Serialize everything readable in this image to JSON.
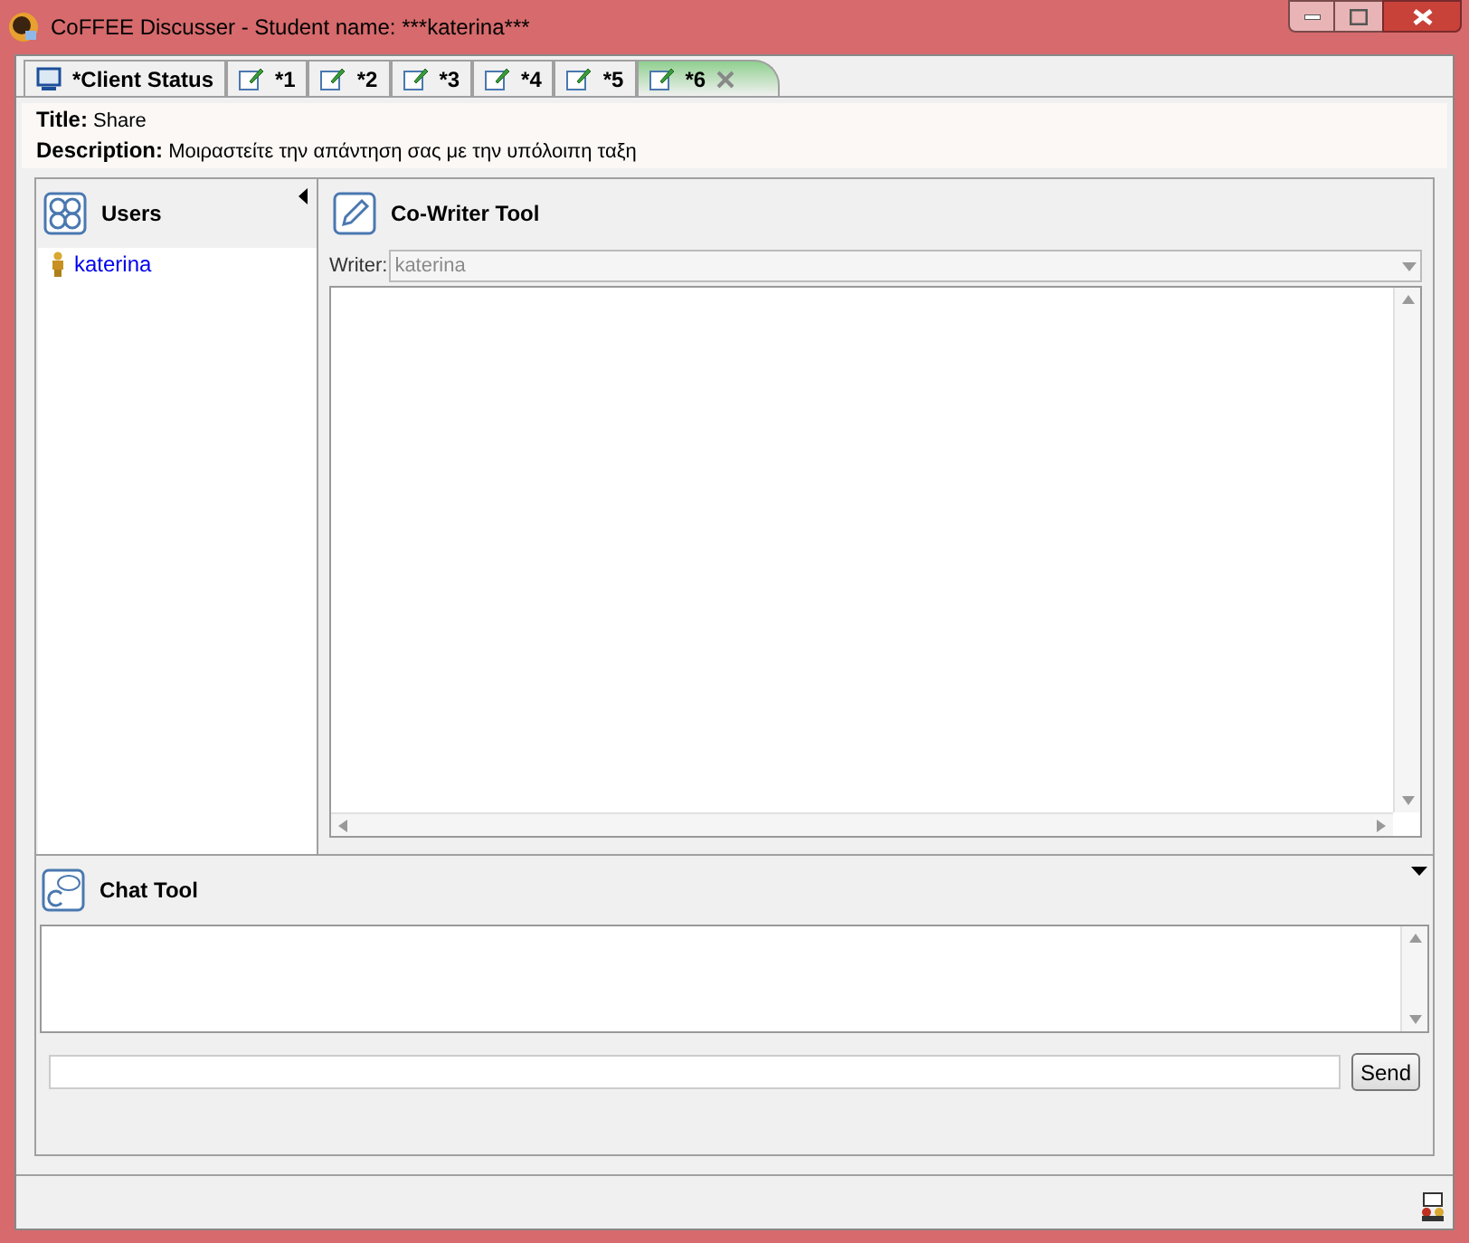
{
  "window": {
    "title": "CoFFEE Discusser - Student name: ***katerina***"
  },
  "tabs": [
    {
      "label": "*Client Status",
      "kind": "status",
      "selected": false
    },
    {
      "label": "*1",
      "kind": "editor",
      "selected": false
    },
    {
      "label": "*2",
      "kind": "editor",
      "selected": false
    },
    {
      "label": "*3",
      "kind": "editor",
      "selected": false
    },
    {
      "label": "*4",
      "kind": "editor",
      "selected": false
    },
    {
      "label": "*5",
      "kind": "editor",
      "selected": false
    },
    {
      "label": "*6",
      "kind": "editor",
      "selected": true
    }
  ],
  "header": {
    "title_label": "Title:",
    "title": "Share",
    "description_label": "Description:",
    "description": "Μοιραστείτε την απάντηση σας με την υπόλοιπη ταξη"
  },
  "users": {
    "title": "Users",
    "items": [
      "katerina"
    ]
  },
  "cowriter": {
    "title": "Co-Writer Tool",
    "writer_label": "Writer:",
    "writer": "katerina"
  },
  "chat": {
    "title": "Chat Tool",
    "send": "Send"
  }
}
